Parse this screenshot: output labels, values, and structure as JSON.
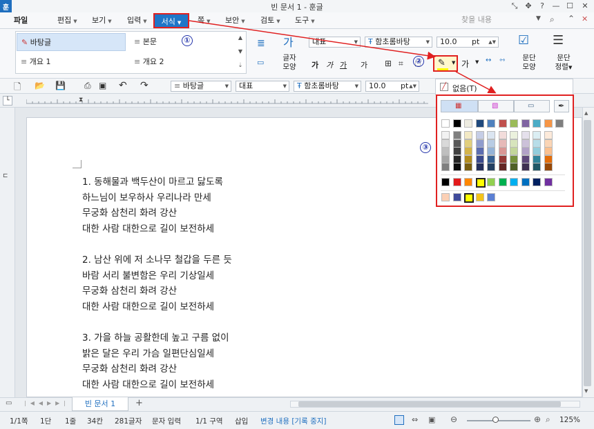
{
  "window": {
    "title": "빈 문서 1 - 훈글",
    "logo": "훈"
  },
  "menus": [
    {
      "label": "파일",
      "dropdown": false
    },
    {
      "label": "편집",
      "dropdown": true
    },
    {
      "label": "보기",
      "dropdown": true
    },
    {
      "label": "입력",
      "dropdown": true
    },
    {
      "label": "서식",
      "dropdown": true
    },
    {
      "label": "쪽",
      "dropdown": true
    },
    {
      "label": "보안",
      "dropdown": true
    },
    {
      "label": "검토",
      "dropdown": true
    },
    {
      "label": "도구",
      "dropdown": true
    }
  ],
  "help_search_placeholder": "찾을 내용",
  "styles_gallery": [
    "바탕글",
    "본문",
    "개요 1",
    "개요 2"
  ],
  "ribbon": {
    "lang_combo": "대표",
    "font_combo": "함초롬바탕",
    "size_value": "10.0",
    "size_unit": "pt",
    "char_shape_label_1": "글자",
    "char_shape_label_2": "모양",
    "para_shape_label_1": "문단",
    "para_shape_label_2": "모양",
    "para_align_label_1": "문단",
    "para_align_label_2": "정렬",
    "format_buttons": [
      "가",
      "가",
      "가",
      "가"
    ]
  },
  "toolbar": {
    "style_combo": "바탕글",
    "lang_combo": "대표",
    "font_combo": "함초롬바탕",
    "size_value": "10.0",
    "size_unit": "pt"
  },
  "annotations": [
    "①",
    "②",
    "③"
  ],
  "document_lines": [
    "1. 동해물과 백두산이 마르고 닳도록",
    "하느님이 보우하사 우리나라 만세",
    "무궁화 삼천리 화려 강산",
    "대한 사람 대한으로 길이 보전하세",
    "",
    "2. 남산 위에 저 소나무 철갑을 두른 듯",
    "바람 서리 불변함은 우리 기상일세",
    "무궁화 삼천리 화려 강산",
    "대한 사람 대한으로 길이 보전하세",
    "",
    "3. 가을 하늘 공활한데 높고 구름 없이",
    "밝은 달은 우리 가슴 일편단심일세",
    "무궁화 삼천리 화려 강산",
    "대한 사람 대한으로 길이 보전하세"
  ],
  "color_popup": {
    "none_label": "없음(T)",
    "top_row": [
      "#ffffff",
      "#000000",
      "#eeece1",
      "#1f497d",
      "#4f81bd",
      "#c0504d",
      "#9bbb59",
      "#8064a2",
      "#4bacc6",
      "#f79646",
      "#7f7f7f"
    ],
    "shade_columns": [
      [
        "#f2f2f2",
        "#d9d9d9",
        "#bfbfbf",
        "#a6a6a6",
        "#808080"
      ],
      [
        "#7f7f7f",
        "#595959",
        "#404040",
        "#262626",
        "#0d0d0d"
      ],
      [
        "#f3e9c4",
        "#e2cf7c",
        "#d4b44a",
        "#b38c1c",
        "#7a5f10"
      ],
      [
        "#c5cde6",
        "#8f9ccd",
        "#5c6db0",
        "#3a4a8c",
        "#232f5c"
      ],
      [
        "#dbe5f1",
        "#b8cce4",
        "#95b3d7",
        "#366092",
        "#244062"
      ],
      [
        "#f2dcdb",
        "#e6b9b8",
        "#d99694",
        "#953735",
        "#632523"
      ],
      [
        "#ebf1dd",
        "#d7e4bc",
        "#c3d69b",
        "#76923c",
        "#4f6128"
      ],
      [
        "#e5e0ec",
        "#ccc1d9",
        "#b2a2c7",
        "#5f497a",
        "#3f3151"
      ],
      [
        "#dbeef3",
        "#b7dde8",
        "#92cddc",
        "#31859b",
        "#205867"
      ],
      [
        "#fdeada",
        "#fbd5b5",
        "#fac08f",
        "#e36c09",
        "#974806"
      ]
    ],
    "standard_row": [
      "#000000",
      "#e31a1c",
      "#ff8800",
      "#ffff00",
      "#92d050",
      "#00b050",
      "#00b0f0",
      "#0070c0",
      "#002060",
      "#7030a0"
    ],
    "recent_row": [
      "#fbd0b5",
      "#3f4a9a",
      "#ffff00",
      "#f3c31a",
      "#5b7fd3"
    ]
  },
  "tab": {
    "doc_name": "빈 문서 1",
    "add": "+"
  },
  "status": {
    "page": "1/1쪽",
    "column": "1단",
    "line": "1줄",
    "col_pos": "34칸",
    "chars": "281글자",
    "mode": "문자 입력",
    "section": "1/1 구역",
    "insert": "삽입",
    "track": "변경 내용 [기록 중지]",
    "zoom": "125%"
  }
}
